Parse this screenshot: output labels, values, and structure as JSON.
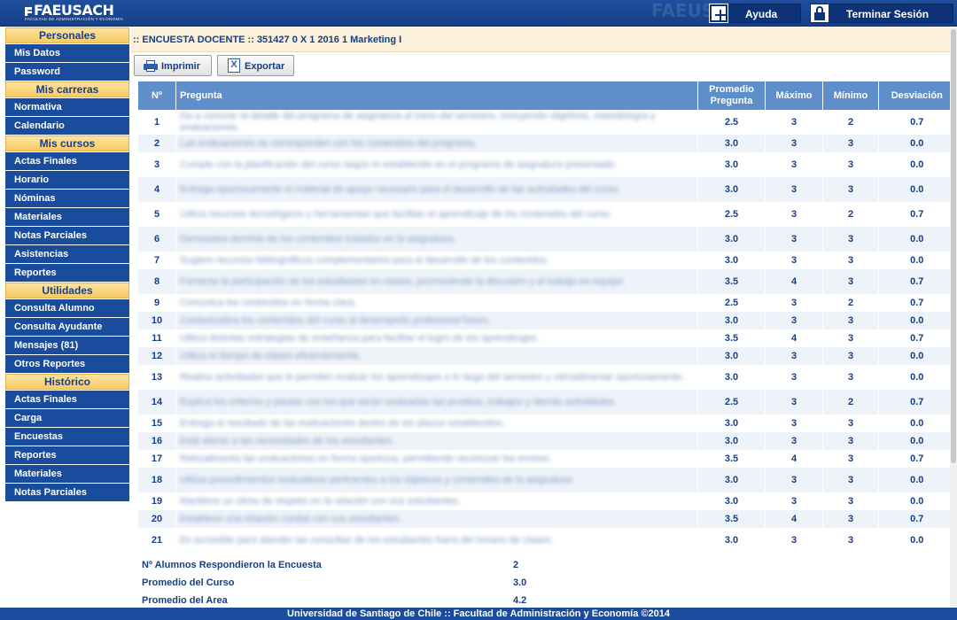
{
  "header": {
    "logo_text": "FAEUSACH",
    "logo_sub": "FACULTAD DE ADMINISTRACIÓN Y ECONOMÍA",
    "watermark": "FAEUSACH",
    "help_label": "Ayuda",
    "logout_label": "Terminar Sesión"
  },
  "sidebar": {
    "sections": [
      {
        "title": "Personales",
        "items": [
          "Mis Datos",
          "Password"
        ]
      },
      {
        "title": "Mis carreras",
        "items": [
          "Normativa",
          "Calendario"
        ]
      },
      {
        "title": "Mis cursos",
        "items": [
          "Actas Finales",
          "Horario",
          "Nóminas",
          "Materiales",
          "Notas Parciales",
          "Asistencias",
          "Reportes"
        ]
      },
      {
        "title": "Utilidades",
        "items": [
          "Consulta Alumno",
          "Consulta Ayudante",
          "Mensajes (81)",
          "Otros Reportes"
        ]
      },
      {
        "title": "Histórico",
        "items": [
          "Actas Finales",
          "Carga",
          "Encuestas",
          "Reportes",
          "Materiales",
          "Notas Parciales"
        ]
      }
    ]
  },
  "page": {
    "title": ":: ENCUESTA DOCENTE :: 351427 0 X 1 2016 1 Marketing I"
  },
  "toolbar": {
    "print_label": "Imprimir",
    "export_label": "Exportar"
  },
  "table": {
    "headers": {
      "num": "Nº",
      "question": "Pregunta",
      "avg_line1": "Promedio",
      "avg_line2": "Pregunta",
      "max": "Máximo",
      "min": "Mínimo",
      "dev": "Desviación"
    },
    "rows": [
      {
        "n": "1",
        "q": "Da a conocer el detalle del programa de asignatura al inicio del semestre, incluyendo objetivos, metodología y evaluaciones.",
        "avg": "2.5",
        "max": "3",
        "min": "2",
        "dev": "0.7"
      },
      {
        "n": "2",
        "q": "Las evaluaciones se corresponden con los contenidos del programa.",
        "avg": "3.0",
        "max": "3",
        "min": "3",
        "dev": "0.0"
      },
      {
        "n": "3",
        "q": "Cumple con la planificación del curso según lo establecido en el programa de asignatura presentado.",
        "avg": "3.0",
        "max": "3",
        "min": "3",
        "dev": "0.0"
      },
      {
        "n": "4",
        "q": "Entrega oportunamente el material de apoyo necesario para el desarrollo de las actividades del curso.",
        "avg": "3.0",
        "max": "3",
        "min": "3",
        "dev": "0.0"
      },
      {
        "n": "5",
        "q": "Utiliza recursos tecnológicos y herramientas que facilitan el aprendizaje de los contenidos del curso.",
        "avg": "2.5",
        "max": "3",
        "min": "2",
        "dev": "0.7"
      },
      {
        "n": "6",
        "q": "Demuestra dominio de los contenidos tratados en la asignatura.",
        "avg": "3.0",
        "max": "3",
        "min": "3",
        "dev": "0.0"
      },
      {
        "n": "7",
        "q": "Sugiere recursos bibliográficos complementarios para el desarrollo de los contenidos.",
        "avg": "3.0",
        "max": "3",
        "min": "3",
        "dev": "0.0"
      },
      {
        "n": "8",
        "q": "Fomenta la participación de los estudiantes en clases, promoviendo la discusión y el trabajo en equipo.",
        "avg": "3.5",
        "max": "4",
        "min": "3",
        "dev": "0.7"
      },
      {
        "n": "9",
        "q": "Comunica los contenidos en forma clara.",
        "avg": "2.5",
        "max": "3",
        "min": "2",
        "dev": "0.7"
      },
      {
        "n": "10",
        "q": "Contextualiza los contenidos del curso al desempeño profesional futuro.",
        "avg": "3.0",
        "max": "3",
        "min": "3",
        "dev": "0.0"
      },
      {
        "n": "11",
        "q": "Utiliza distintas estrategias de enseñanza para facilitar el logro de los aprendizajes.",
        "avg": "3.5",
        "max": "4",
        "min": "3",
        "dev": "0.7"
      },
      {
        "n": "12",
        "q": "Utiliza el tiempo de clases eficientemente.",
        "avg": "3.0",
        "max": "3",
        "min": "3",
        "dev": "0.0"
      },
      {
        "n": "13",
        "q": "Realiza actividades que le permiten evaluar los aprendizajes a lo largo del semestre y retroalimentar oportunamente.",
        "avg": "3.0",
        "max": "3",
        "min": "3",
        "dev": "0.0"
      },
      {
        "n": "14",
        "q": "Explica los criterios y pautas con los que serán evaluadas las pruebas, trabajos y demás actividades.",
        "avg": "2.5",
        "max": "3",
        "min": "2",
        "dev": "0.7"
      },
      {
        "n": "15",
        "q": "Entrega el resultado de las evaluaciones dentro de los plazos establecidos.",
        "avg": "3.0",
        "max": "3",
        "min": "3",
        "dev": "0.0"
      },
      {
        "n": "16",
        "q": "Está atento a las necesidades de los estudiantes.",
        "avg": "3.0",
        "max": "3",
        "min": "3",
        "dev": "0.0"
      },
      {
        "n": "17",
        "q": "Retroalimenta las evaluaciones en forma oportuna, permitiendo reconocer los errores.",
        "avg": "3.5",
        "max": "4",
        "min": "3",
        "dev": "0.7"
      },
      {
        "n": "18",
        "q": "Utiliza procedimientos evaluativos pertinentes a los objetivos y contenidos de la asignatura.",
        "avg": "3.0",
        "max": "3",
        "min": "3",
        "dev": "0.0"
      },
      {
        "n": "19",
        "q": "Mantiene un clima de respeto en la relación con sus estudiantes.",
        "avg": "3.0",
        "max": "3",
        "min": "3",
        "dev": "0.0"
      },
      {
        "n": "20",
        "q": "Establece una relación cordial con sus estudiantes.",
        "avg": "3.5",
        "max": "4",
        "min": "3",
        "dev": "0.7"
      },
      {
        "n": "21",
        "q": "Es accesible para atender las consultas de los estudiantes fuera del horario de clases.",
        "avg": "3.0",
        "max": "3",
        "min": "3",
        "dev": "0.0"
      }
    ]
  },
  "summary": [
    {
      "label": "Nº Alumnos Respondieron la Encuesta",
      "value": "2"
    },
    {
      "label": "Promedio del Curso",
      "value": "3.0"
    },
    {
      "label": "Promedio del Area",
      "value": "4.2"
    }
  ],
  "footer": {
    "text": "Universidad de Santiago de Chile :: Facultad de Administración y Economía ©2014"
  },
  "colors": {
    "primary_blue": "#1a4c9d",
    "header_blue": "#163f86",
    "table_header": "#5e8fcb",
    "section_gold": "#f7c963",
    "title_bg": "#fbf0d9"
  },
  "icons": {
    "help": "plus-square-icon",
    "logout": "lock-icon",
    "print": "printer-icon",
    "export": "excel-icon"
  }
}
